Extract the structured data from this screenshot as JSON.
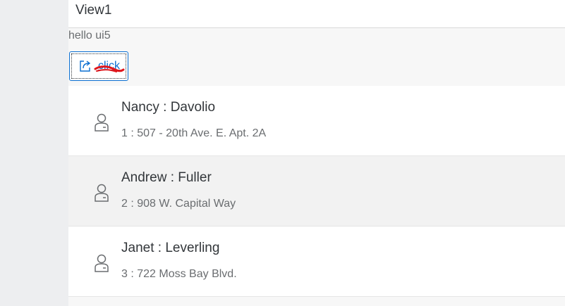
{
  "view": {
    "title": "View1"
  },
  "content": {
    "greeting": "hello ui5"
  },
  "button": {
    "label": "click",
    "icon": "external-link-icon"
  },
  "list": {
    "items": [
      {
        "title": "Nancy : Davolio",
        "description": "1 : 507 - 20th Ave. E. Apt. 2A",
        "icon": "person-icon"
      },
      {
        "title": "Andrew : Fuller",
        "description": "2 : 908 W. Capital Way",
        "icon": "person-icon"
      },
      {
        "title": "Janet : Leverling",
        "description": "3 : 722 Moss Bay Blvd.",
        "icon": "person-icon"
      }
    ]
  },
  "colors": {
    "accent": "#0a6ed1",
    "annotation": "#e0161b",
    "text": "#32363a",
    "subtext": "#6a6d70"
  }
}
